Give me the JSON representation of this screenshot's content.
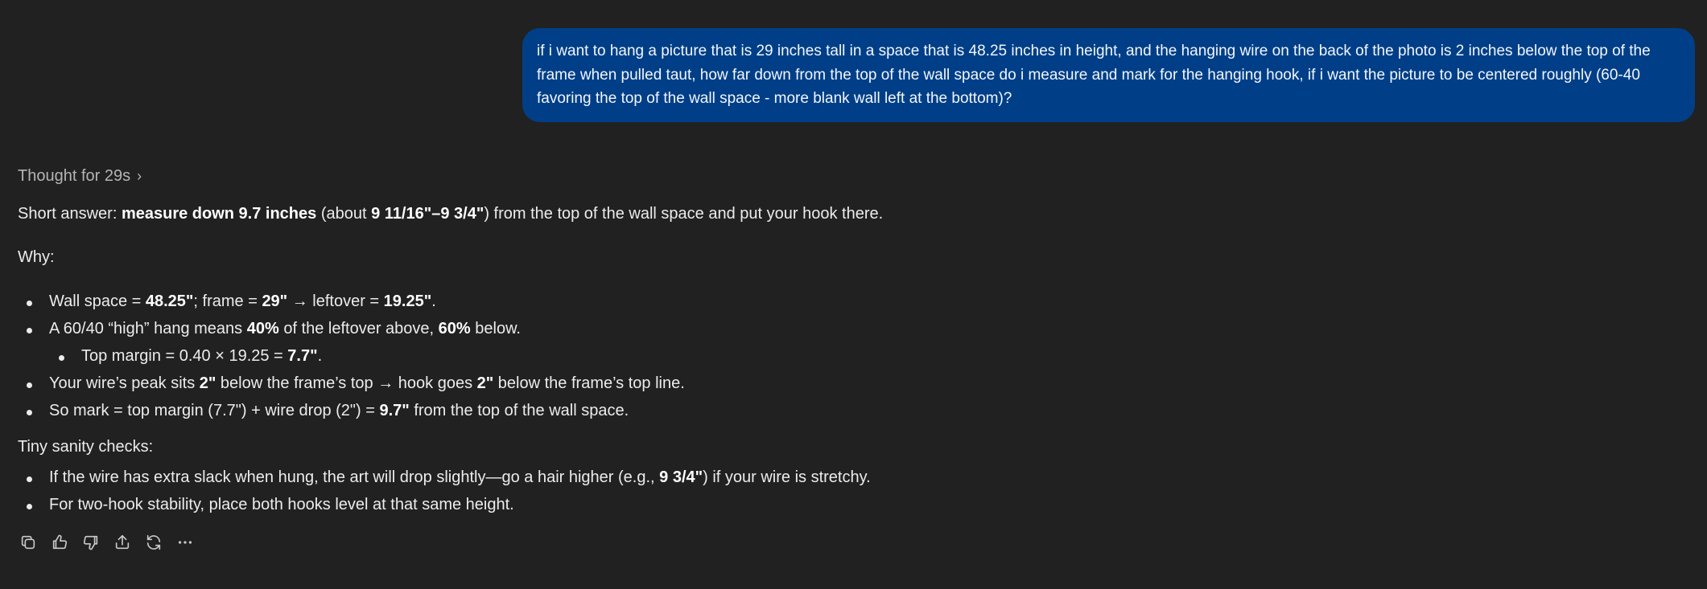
{
  "user_message": "if i want to hang a picture that is 29 inches tall in a space that is 48.25 inches in height, and the hanging wire on the back of the photo is 2 inches below the top of the frame when pulled taut, how far down from the top of the wall space do i measure and mark for the hanging hook, if i want the picture to be centered roughly (60-40 favoring the top of the wall space - more blank wall left at the bottom)?",
  "thought_label": "Thought for 29s",
  "answer": {
    "short": {
      "prefix": "Short answer: ",
      "bold1": "measure down 9.7 inches",
      "mid": " (about ",
      "bold2": "9 11/16\"–9 3/4\"",
      "suffix": ") from the top of the wall space and put your hook there."
    },
    "why_label": "Why:",
    "why_items": [
      {
        "t1": "Wall space = ",
        "b1": "48.25\"",
        "t2": "; frame = ",
        "b2": "29\"",
        "t3": " → leftover = ",
        "b3": "19.25\"",
        "t4": "."
      },
      {
        "t1": "A 60/40 “high” hang means ",
        "b1": "40%",
        "t2": " of the leftover above, ",
        "b2": "60%",
        "t3": " below."
      },
      {
        "t1": "Top margin = 0.40 × 19.25 = ",
        "b1": "7.7\"",
        "t2": "."
      },
      {
        "t1": "Your wire’s peak sits ",
        "b1": "2\"",
        "t2": " below the frame’s top → hook goes ",
        "b2": "2\"",
        "t3": " below the frame’s top line."
      },
      {
        "t1": "So mark = top margin (7.7\") + wire drop (2\") = ",
        "b1": "9.7\"",
        "t2": " from the top of the wall space."
      }
    ],
    "sanity_label": "Tiny sanity checks:",
    "sanity_items": [
      {
        "t1": "If the wire has extra slack when hung, the art will drop slightly—go a hair higher (e.g., ",
        "b1": "9 3/4\"",
        "t2": ") if your wire is stretchy."
      },
      {
        "t1": "For two-hook stability, place both hooks level at that same height."
      }
    ]
  },
  "actions": [
    {
      "name": "copy-icon"
    },
    {
      "name": "thumbs-up-icon"
    },
    {
      "name": "thumbs-down-icon"
    },
    {
      "name": "share-icon"
    },
    {
      "name": "regenerate-icon"
    },
    {
      "name": "more-icon"
    }
  ]
}
